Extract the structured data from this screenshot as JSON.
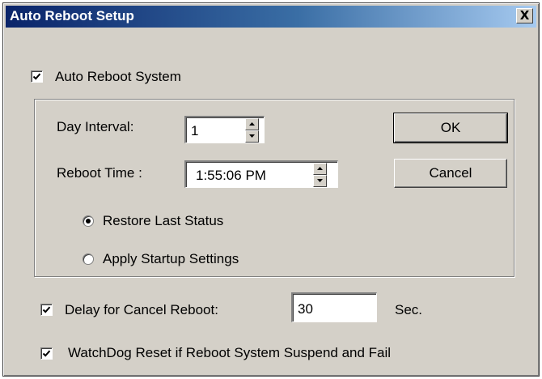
{
  "window": {
    "title": "Auto Reboot Setup",
    "close_symbol": "X",
    "close_icon": "close-icon"
  },
  "auto_reboot": {
    "label": "Auto Reboot System",
    "checked": true
  },
  "schedule": {
    "day_interval": {
      "label": "Day Interval:",
      "value": "1"
    },
    "reboot_time": {
      "label": "Reboot Time :",
      "value": "1:55:06 PM"
    },
    "restore_last_status": {
      "label": "Restore Last Status",
      "selected": true
    },
    "apply_startup_settings": {
      "label": "Apply Startup Settings",
      "selected": false
    }
  },
  "buttons": {
    "ok": "OK",
    "cancel": "Cancel"
  },
  "delay": {
    "label": "Delay for Cancel Reboot:",
    "value": "30",
    "unit": "Sec.",
    "checked": true
  },
  "watchdog": {
    "label": "WatchDog Reset if Reboot System Suspend and Fail",
    "checked": true
  },
  "colors": {
    "titlebar_start": "#0a246a",
    "titlebar_end": "#a6caf0",
    "dialog_face": "#d4d0c8"
  }
}
